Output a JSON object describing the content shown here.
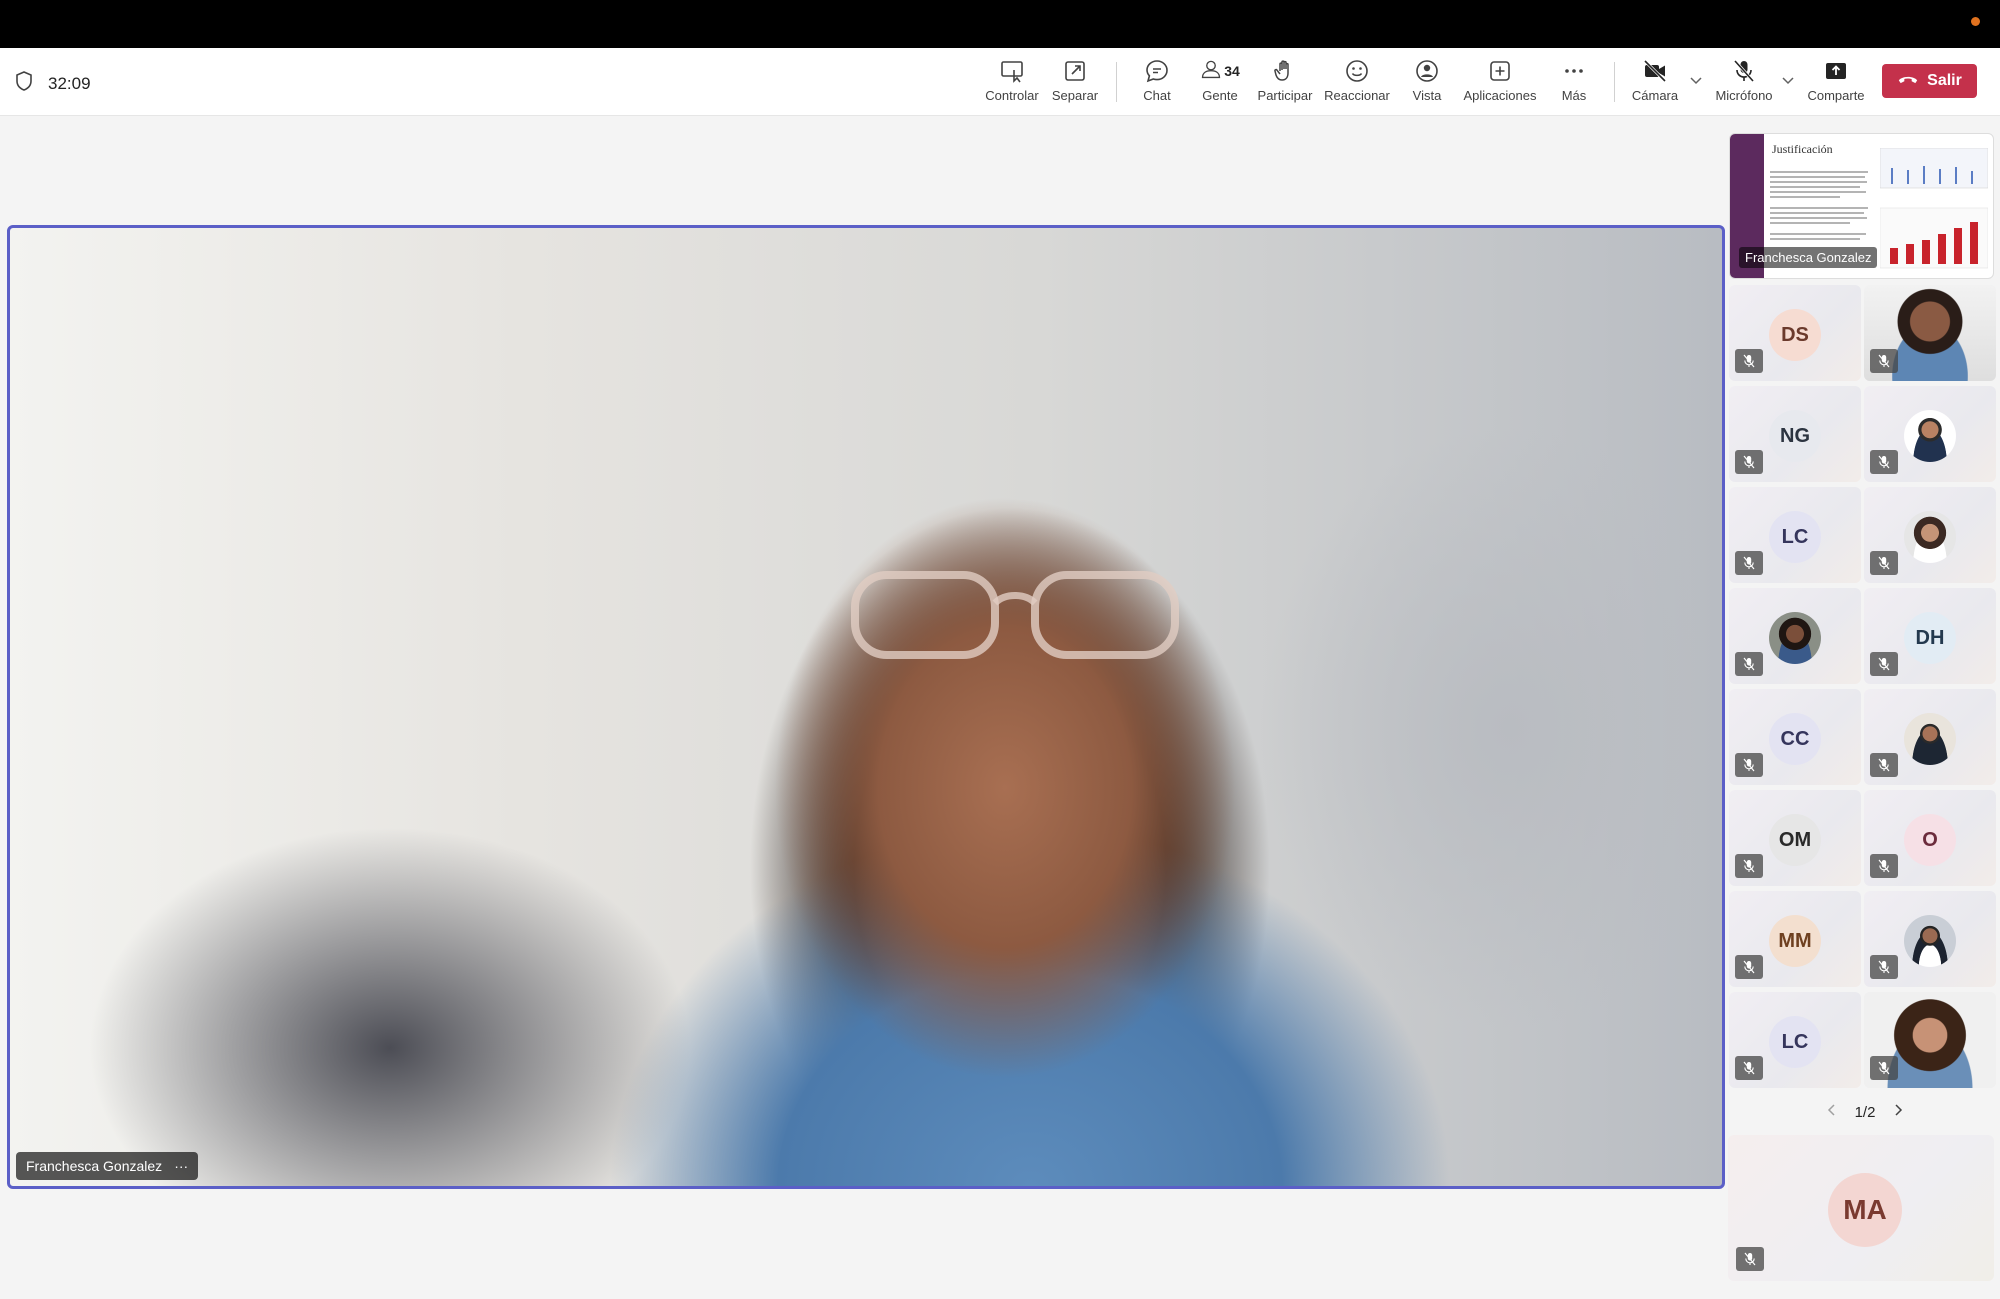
{
  "meeting": {
    "timer": "32:09"
  },
  "toolbar": {
    "controlar": "Controlar",
    "separar": "Separar",
    "chat": "Chat",
    "gente": "Gente",
    "people_count": "34",
    "participar": "Participar",
    "reaccionar": "Reaccionar",
    "vista": "Vista",
    "aplicaciones": "Aplicaciones",
    "mas": "Más",
    "camara": "Cámara",
    "microfono": "Micrófono",
    "comparte": "Comparte",
    "salir": "Salir"
  },
  "main_video": {
    "speaker_name": "Franchesca Gonzalez",
    "more_options": "···"
  },
  "share_tile": {
    "slide_title": "Justificación",
    "presenter_name": "Franchesca Gonzalez"
  },
  "participants": [
    {
      "initials": "DS",
      "avatar_color": "#f6dcd2",
      "text_color": "#6b3a2c"
    },
    {
      "photo": "woman-video"
    },
    {
      "initials": "NG",
      "avatar_color": "#e7e9ee",
      "text_color": "#2c3440"
    },
    {
      "photo": "man-suit"
    },
    {
      "initials": "LC",
      "avatar_color": "#e3e3f2",
      "text_color": "#35355c"
    },
    {
      "photo": "woman-glasses"
    },
    {
      "photo": "woman-dark"
    },
    {
      "initials": "DH",
      "avatar_color": "#e2ecf4",
      "text_color": "#23394e"
    },
    {
      "initials": "CC",
      "avatar_color": "#e3e3f2",
      "text_color": "#35355c"
    },
    {
      "photo": "man-desk"
    },
    {
      "initials": "OM",
      "avatar_color": "#e6e6e6",
      "text_color": "#2a2a2a"
    },
    {
      "initials": "O",
      "avatar_color": "#f6e0e6",
      "text_color": "#6b2c3c"
    },
    {
      "initials": "MM",
      "avatar_color": "#f3dfcf",
      "text_color": "#6e4020"
    },
    {
      "photo": "man-office"
    },
    {
      "initials": "LC",
      "avatar_color": "#e3e3f2",
      "text_color": "#35355c"
    },
    {
      "photo": "woman-curly"
    }
  ],
  "pager": {
    "page": "1/2"
  },
  "spotlight": {
    "initials": "MA"
  },
  "colors": {
    "accent": "#5b5fc7",
    "leave": "#c4314b"
  }
}
